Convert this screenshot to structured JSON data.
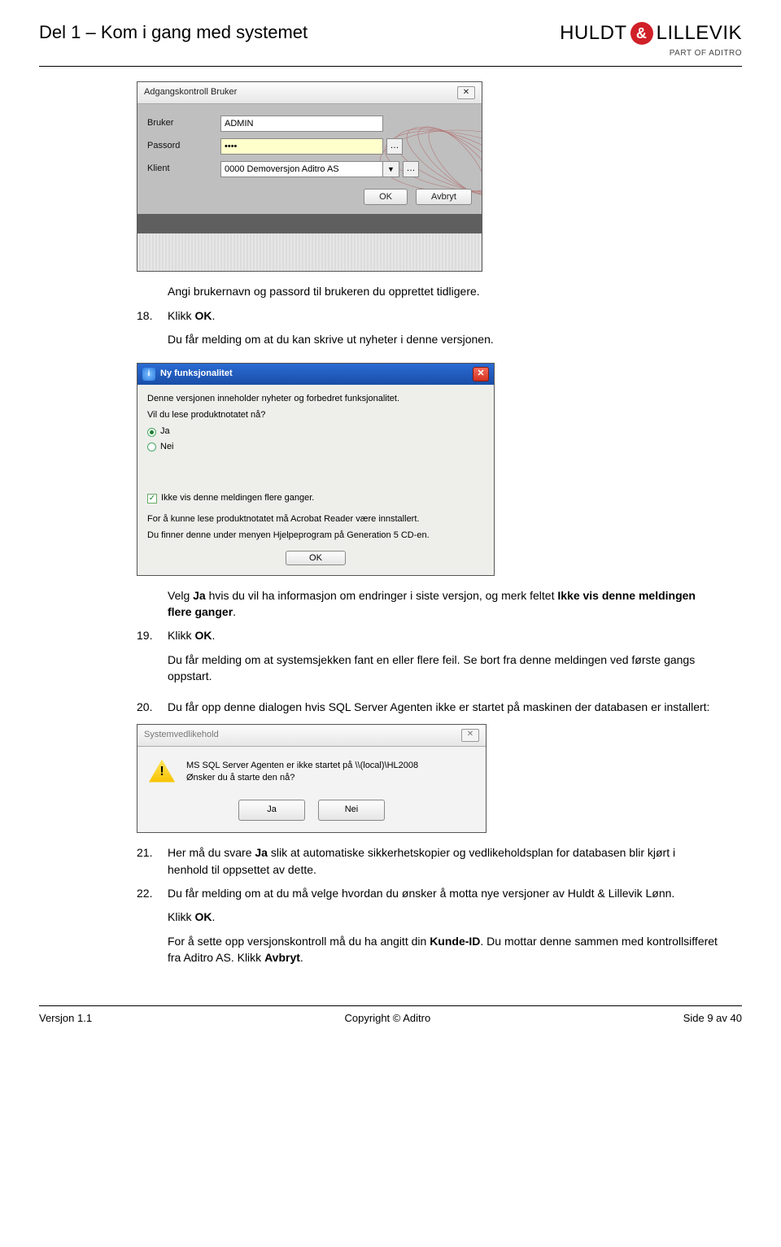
{
  "header": {
    "page_title": "Del 1 – Kom i gang med systemet",
    "brand_left": "HULDT",
    "brand_amp": "&",
    "brand_right": "LILLEVIK",
    "brand_sub": "PART OF ADITRO"
  },
  "dialog1": {
    "title": "Adgangskontroll Bruker",
    "label_bruker": "Bruker",
    "label_passord": "Passord",
    "label_klient": "Klient",
    "value_bruker": "ADMIN",
    "value_passord": "••••",
    "value_klient": "0000 Demoversjon Aditro AS",
    "btn_ok": "OK",
    "btn_avbryt": "Avbryt"
  },
  "text": {
    "p1": "Angi brukernavn og passord til brukeren du opprettet tidligere.",
    "s18_num": "18.",
    "s18a": "Klikk ",
    "s18b": "OK",
    "s18c": ".",
    "p2": "Du får melding om at du kan skrive ut nyheter i denne versjonen.",
    "p3a": "Velg ",
    "p3b": "Ja",
    "p3c": " hvis du vil ha informasjon om endringer i siste versjon, og merk feltet ",
    "p3d": "Ikke vis denne meldingen flere ganger",
    "p3e": ".",
    "s19_num": "19.",
    "s19a": "Klikk ",
    "s19b": "OK",
    "s19c": ".",
    "p4": "Du får melding om at systemsjekken fant en eller flere feil. Se bort fra denne meldingen ved første gangs oppstart.",
    "s20_num": "20.",
    "s20": "Du får opp denne dialogen hvis SQL Server Agenten ikke er startet på maskinen der databasen er installert:",
    "s21_num": "21.",
    "s21a": "Her må du svare ",
    "s21b": "Ja",
    "s21c": " slik at automatiske sikkerhetskopier og vedlikeholdsplan for databasen blir kjørt i henhold til oppsettet av dette.",
    "s22_num": "22.",
    "s22": "Du får melding om at du må velge hvordan du ønsker å motta nye versjoner av Huldt & Lillevik Lønn.",
    "p5a": "Klikk ",
    "p5b": "OK",
    "p5c": ".",
    "p6a": "For å sette opp versjonskontroll må du ha angitt din ",
    "p6b": "Kunde-ID",
    "p6c": ". Du mottar denne sammen med kontrollsifferet fra Aditro AS. Klikk ",
    "p6d": "Avbryt",
    "p6e": "."
  },
  "dialog2": {
    "title": "Ny funksjonalitet",
    "line1": "Denne versjonen inneholder nyheter og forbedret funksjonalitet.",
    "line2": "Vil du lese produktnotatet nå?",
    "opt_ja": "Ja",
    "opt_nei": "Nei",
    "chk": "Ikke vis denne meldingen flere ganger.",
    "info1": "For å kunne lese produktnotatet må Acrobat Reader være innstallert.",
    "info2": "Du finner denne under menyen Hjelpeprogram på Generation 5 CD-en.",
    "btn_ok": "OK"
  },
  "dialog3": {
    "title": "Systemvedlikehold",
    "msg1": "MS SQL Server Agenten er ikke startet på \\\\(local)\\HL2008",
    "msg2": "Ønsker du å starte den nå?",
    "btn_ja": "Ja",
    "btn_nei": "Nei"
  },
  "footer": {
    "left": "Versjon 1.1",
    "center": "Copyright © Aditro",
    "right": "Side 9 av 40"
  }
}
